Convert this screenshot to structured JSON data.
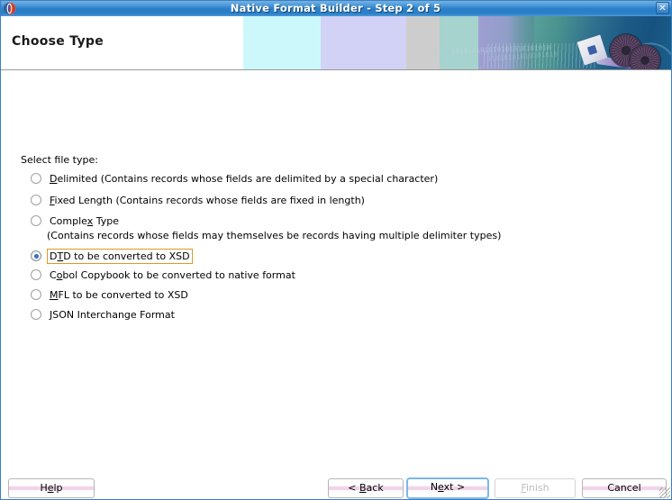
{
  "window": {
    "title": "Native Format Builder - Step 2 of 5",
    "app_icon": "oracle-logo-icon",
    "close_label": "✕",
    "accent_title_bar": "#2a7fc8",
    "focus_color": "#d89a2a",
    "button_focus_color": "#7cb8ea"
  },
  "banner": {
    "heading": "Choose Type",
    "binary_text_1": "101010101010101010101010",
    "binary_text_2": "01010101010101010",
    "binary_text_3": "1010101010101010101",
    "art": "gears-envelope-illustration"
  },
  "content": {
    "select_label": "Select file type:",
    "options": [
      {
        "id": "delimited",
        "pre": "",
        "mnemonic": "D",
        "post": "elimited (Contains records whose fields are delimited by a special character)",
        "selected": false,
        "focused": false
      },
      {
        "id": "fixed-length",
        "pre": "",
        "mnemonic": "F",
        "post": "ixed Length (Contains records whose fields are fixed in length)",
        "selected": false,
        "focused": false
      },
      {
        "id": "complex-type",
        "pre": "Comple",
        "mnemonic": "x",
        "post": " Type",
        "selected": false,
        "focused": false
      },
      {
        "id": "dtd-to-xsd",
        "pre": "D",
        "mnemonic": "T",
        "post": "D to be converted to XSD",
        "selected": true,
        "focused": true
      },
      {
        "id": "cobol-copybook",
        "pre": "C",
        "mnemonic": "o",
        "post": "bol Copybook to be converted to native format",
        "selected": false,
        "focused": false
      },
      {
        "id": "mfl-to-xsd",
        "pre": "",
        "mnemonic": "M",
        "post": "FL to be converted to XSD",
        "selected": false,
        "focused": false
      },
      {
        "id": "json-interchange",
        "pre": "",
        "mnemonic": "J",
        "post": "SON Interchange Format",
        "selected": false,
        "focused": false
      }
    ],
    "complex_type_description": "(Contains records whose fields may themselves be records having multiple delimiter types)"
  },
  "buttons": {
    "help": {
      "pre": "H",
      "mnemonic": "e",
      "post": "lp",
      "disabled": false,
      "focused": false
    },
    "back": {
      "pre": "< ",
      "mnemonic": "B",
      "post": "ack",
      "disabled": false,
      "focused": false
    },
    "next": {
      "pre": "N",
      "mnemonic": "e",
      "post": "xt >",
      "disabled": false,
      "focused": true
    },
    "finish": {
      "pre": "",
      "mnemonic": "F",
      "post": "inish",
      "disabled": true,
      "focused": false
    },
    "cancel": {
      "pre": "Cancel",
      "mnemonic": "",
      "post": "",
      "disabled": false,
      "focused": false
    }
  }
}
